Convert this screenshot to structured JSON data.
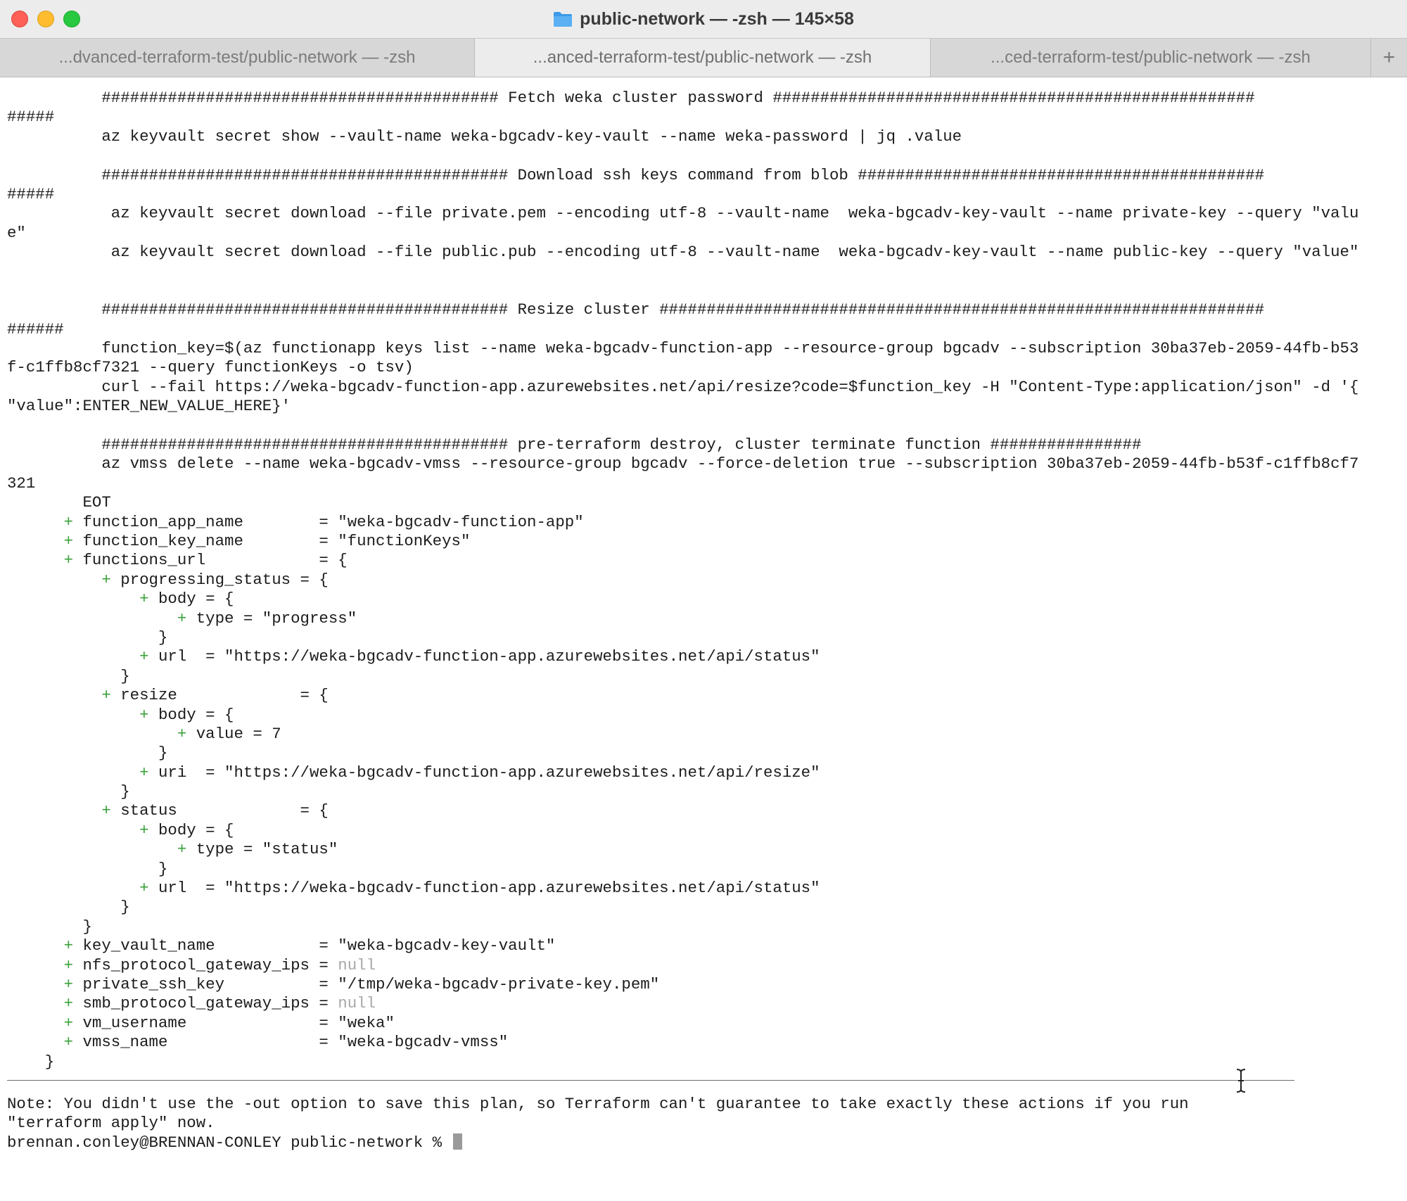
{
  "window": {
    "title": "public-network — -zsh — 145×58",
    "tabs": [
      {
        "label": "...dvanced-terraform-test/public-network — -zsh"
      },
      {
        "label": "...anced-terraform-test/public-network — -zsh"
      },
      {
        "label": "...ced-terraform-test/public-network — -zsh"
      }
    ],
    "new_tab_label": "+"
  },
  "terminal": {
    "lines": [
      [
        {
          "t": "          ########################################## Fetch weka cluster password ###################################################"
        }
      ],
      [
        {
          "t": "#####"
        }
      ],
      [
        {
          "t": "          az keyvault secret show --vault-name weka-bgcadv-key-vault --name weka-password | jq .value"
        }
      ],
      [
        {
          "t": ""
        }
      ],
      [
        {
          "t": "          ########################################### Download ssh keys command from blob ###########################################"
        }
      ],
      [
        {
          "t": "#####"
        }
      ],
      [
        {
          "t": "           az keyvault secret download --file private.pem --encoding utf-8 --vault-name  weka-bgcadv-key-vault --name private-key --query \"valu"
        }
      ],
      [
        {
          "t": "e\""
        }
      ],
      [
        {
          "t": "           az keyvault secret download --file public.pub --encoding utf-8 --vault-name  weka-bgcadv-key-vault --name public-key --query \"value\""
        }
      ],
      [
        {
          "t": ""
        }
      ],
      [
        {
          "t": ""
        }
      ],
      [
        {
          "t": "          ########################################### Resize cluster ################################################################"
        }
      ],
      [
        {
          "t": "######"
        }
      ],
      [
        {
          "t": "          function_key=$(az functionapp keys list --name weka-bgcadv-function-app --resource-group bgcadv --subscription 30ba37eb-2059-44fb-b53"
        }
      ],
      [
        {
          "t": "f-c1ffb8cf7321 --query functionKeys -o tsv)"
        }
      ],
      [
        {
          "t": "          curl --fail https://weka-bgcadv-function-app.azurewebsites.net/api/resize?code=$function_key -H \"Content-Type:application/json\" -d '{"
        }
      ],
      [
        {
          "t": "\"value\":ENTER_NEW_VALUE_HERE}'"
        }
      ],
      [
        {
          "t": ""
        }
      ],
      [
        {
          "t": "          ########################################### pre-terraform destroy, cluster terminate function ################"
        }
      ],
      [
        {
          "t": "          az vmss delete --name weka-bgcadv-vmss --resource-group bgcadv --force-deletion true --subscription 30ba37eb-2059-44fb-b53f-c1ffb8cf7"
        }
      ],
      [
        {
          "t": "321"
        }
      ],
      [
        {
          "t": "        EOT"
        }
      ],
      [
        {
          "t": "      "
        },
        {
          "t": "+",
          "c": "plus"
        },
        {
          "t": " function_app_name        = \"weka-bgcadv-function-app\""
        }
      ],
      [
        {
          "t": "      "
        },
        {
          "t": "+",
          "c": "plus"
        },
        {
          "t": " function_key_name        = \"functionKeys\""
        }
      ],
      [
        {
          "t": "      "
        },
        {
          "t": "+",
          "c": "plus"
        },
        {
          "t": " functions_url            = {"
        }
      ],
      [
        {
          "t": "          "
        },
        {
          "t": "+",
          "c": "plus"
        },
        {
          "t": " progressing_status = {"
        }
      ],
      [
        {
          "t": "              "
        },
        {
          "t": "+",
          "c": "plus"
        },
        {
          "t": " body = {"
        }
      ],
      [
        {
          "t": "                  "
        },
        {
          "t": "+",
          "c": "plus"
        },
        {
          "t": " type = \"progress\""
        }
      ],
      [
        {
          "t": "                }"
        }
      ],
      [
        {
          "t": "              "
        },
        {
          "t": "+",
          "c": "plus"
        },
        {
          "t": " url  = \"https://weka-bgcadv-function-app.azurewebsites.net/api/status\""
        }
      ],
      [
        {
          "t": "            }"
        }
      ],
      [
        {
          "t": "          "
        },
        {
          "t": "+",
          "c": "plus"
        },
        {
          "t": " resize             = {"
        }
      ],
      [
        {
          "t": "              "
        },
        {
          "t": "+",
          "c": "plus"
        },
        {
          "t": " body = {"
        }
      ],
      [
        {
          "t": "                  "
        },
        {
          "t": "+",
          "c": "plus"
        },
        {
          "t": " value = 7"
        }
      ],
      [
        {
          "t": "                }"
        }
      ],
      [
        {
          "t": "              "
        },
        {
          "t": "+",
          "c": "plus"
        },
        {
          "t": " uri  = \"https://weka-bgcadv-function-app.azurewebsites.net/api/resize\""
        }
      ],
      [
        {
          "t": "            }"
        }
      ],
      [
        {
          "t": "          "
        },
        {
          "t": "+",
          "c": "plus"
        },
        {
          "t": " status             = {"
        }
      ],
      [
        {
          "t": "              "
        },
        {
          "t": "+",
          "c": "plus"
        },
        {
          "t": " body = {"
        }
      ],
      [
        {
          "t": "                  "
        },
        {
          "t": "+",
          "c": "plus"
        },
        {
          "t": " type = \"status\""
        }
      ],
      [
        {
          "t": "                }"
        }
      ],
      [
        {
          "t": "              "
        },
        {
          "t": "+",
          "c": "plus"
        },
        {
          "t": " url  = \"https://weka-bgcadv-function-app.azurewebsites.net/api/status\""
        }
      ],
      [
        {
          "t": "            }"
        }
      ],
      [
        {
          "t": "        }"
        }
      ],
      [
        {
          "t": "      "
        },
        {
          "t": "+",
          "c": "plus"
        },
        {
          "t": " key_vault_name           = \"weka-bgcadv-key-vault\""
        }
      ],
      [
        {
          "t": "      "
        },
        {
          "t": "+",
          "c": "plus"
        },
        {
          "t": " nfs_protocol_gateway_ips = "
        },
        {
          "t": "null",
          "c": "null"
        }
      ],
      [
        {
          "t": "      "
        },
        {
          "t": "+",
          "c": "plus"
        },
        {
          "t": " private_ssh_key          = \"/tmp/weka-bgcadv-private-key.pem\""
        }
      ],
      [
        {
          "t": "      "
        },
        {
          "t": "+",
          "c": "plus"
        },
        {
          "t": " smb_protocol_gateway_ips = "
        },
        {
          "t": "null",
          "c": "null"
        }
      ],
      [
        {
          "t": "      "
        },
        {
          "t": "+",
          "c": "plus"
        },
        {
          "t": " vm_username              = \"weka\""
        }
      ],
      [
        {
          "t": "      "
        },
        {
          "t": "+",
          "c": "plus"
        },
        {
          "t": " vmss_name                = \"weka-bgcadv-vmss\""
        }
      ],
      [
        {
          "t": "    }"
        }
      ]
    ],
    "note_lines": [
      "Note: You didn't use the -out option to save this plan, so Terraform can't guarantee to take exactly these actions if you run",
      "\"terraform apply\" now."
    ],
    "prompt": "brennan.conley@BRENNAN-CONLEY public-network % "
  },
  "colors": {
    "plus": "#3aa13a",
    "null": "#a8a8a8",
    "text": "#1c1c1c",
    "titlebar": "#ececec",
    "tabbar": "#d7d7d7"
  },
  "icons": {
    "title_icon": "folder-icon",
    "mouse_cursor": "ibeam-cursor-icon"
  }
}
